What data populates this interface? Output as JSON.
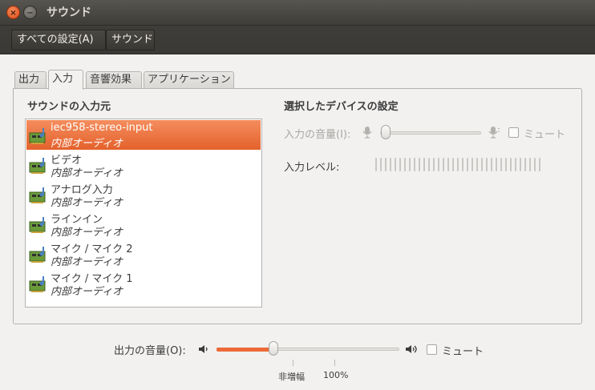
{
  "window": {
    "title": "サウンド",
    "close_glyph": "×",
    "minimize_glyph": "−"
  },
  "breadcrumb": {
    "all_settings": "すべての設定(A)",
    "current": "サウンド"
  },
  "tabs": [
    {
      "label": "出力"
    },
    {
      "label": "入力",
      "active": true
    },
    {
      "label": "音響効果"
    },
    {
      "label": "アプリケーション"
    }
  ],
  "input_sources": {
    "title": "サウンドの入力元",
    "devices": [
      {
        "name": "iec958-stereo-input",
        "subtitle": "内部オーディオ",
        "selected": true
      },
      {
        "name": "ビデオ",
        "subtitle": "内部オーディオ"
      },
      {
        "name": "アナログ入力",
        "subtitle": "内部オーディオ"
      },
      {
        "name": "ラインイン",
        "subtitle": "内部オーディオ"
      },
      {
        "name": "マイク / マイク 2",
        "subtitle": "内部オーディオ"
      },
      {
        "name": "マイク / マイク 1",
        "subtitle": "内部オーディオ"
      }
    ],
    "device_icon": "sound-card-icon"
  },
  "device_settings": {
    "title": "選択したデバイスの設定",
    "input_volume_label": "入力の音量(I):",
    "mute_label": "ミュート",
    "input_level_label": "入力レベル:",
    "input_volume": 0.0,
    "input_muted": false,
    "disabled": true
  },
  "output": {
    "volume_label": "出力の音量(O):",
    "mute_label": "ミュート",
    "muted": false,
    "volume_fraction": 0.31,
    "marks": [
      "非増幅",
      "100%"
    ]
  },
  "colors": {
    "accent": "#e9652e",
    "titlebar": "#3c3b37"
  }
}
